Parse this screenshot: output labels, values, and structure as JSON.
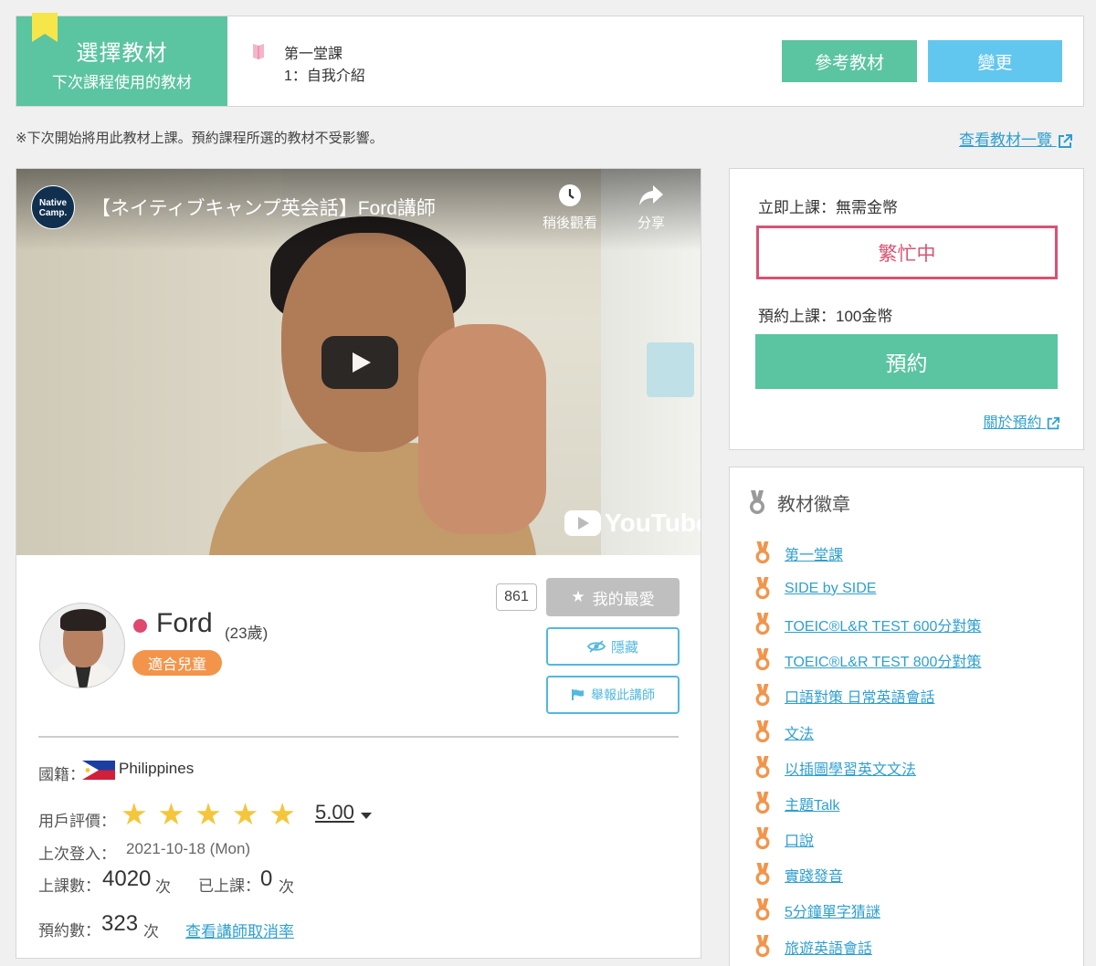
{
  "material": {
    "title": "選擇教材",
    "subtitle": "下次課程使用的教材",
    "lesson": "第一堂課",
    "lesson_name": "1：自我介紹",
    "ref_button": "參考教材",
    "change_button": "變更"
  },
  "notice": "※下次開始將用此教材上課。預約課程所選的教材不受影響。",
  "material_list_link": "查看教材一覽",
  "video": {
    "channel_logo": "Native Camp.",
    "title": "【ネイティブキャンプ英会話】Ford講師",
    "watch_later": "稍後觀看",
    "share": "分享",
    "brand": "YouTube"
  },
  "teacher": {
    "name": "Ford",
    "age": "(23歲)",
    "kid_badge": "適合兒童",
    "fav_count": "861",
    "fav_button": "我的最愛",
    "hide_button": "隱藏",
    "report_button": "舉報此講師",
    "nationality_label": "國籍：",
    "nationality": "Philippines",
    "rating_label": "用戶評價：",
    "rating_stars": 5,
    "rating": "5.00",
    "last_login_label": "上次登入：",
    "last_login": "2021-10-18 (Mon)",
    "lessons_label": "上課數：",
    "lessons": "4020",
    "lessons_unit": "次",
    "taken_label": "已上課：",
    "taken": "0",
    "taken_unit": "次",
    "reservations_label": "預約數：",
    "reservations": "323",
    "reservations_unit": "次",
    "cancel_rate_link": "查看講師取消率"
  },
  "booking": {
    "now_label": "立即上課：無需金幣",
    "busy_button": "繁忙中",
    "reserve_label": "預約上課：100金幣",
    "reserve_button": "預約",
    "about_link": "關於預約"
  },
  "badges": {
    "title": "教材徽章",
    "items": [
      "第一堂課",
      "SIDE by SIDE",
      "TOEIC®L&R TEST 600分對策",
      "TOEIC®L&R TEST 800分對策",
      "口語對策 日常英語會話",
      "文法",
      "以插圖學習英文文法",
      "主題Talk",
      "口說",
      "實踐發音",
      "5分鐘單字猜謎",
      "旅遊英語會話"
    ]
  },
  "colors": {
    "green": "#5bc4a0",
    "blue": "#62c7ee",
    "busy_red": "#d85272",
    "link": "#2f9fcf",
    "badge_orange": "#f2954b",
    "star": "#f5c63c"
  }
}
